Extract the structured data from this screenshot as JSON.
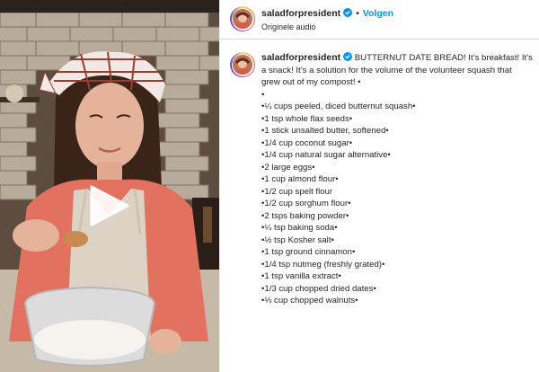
{
  "header": {
    "username": "saladforpresident",
    "verified_icon": "verified-badge-icon",
    "follow_label": "Volgen",
    "audio_label": "Originele audio"
  },
  "caption": {
    "username": "saladforpresident",
    "lead_text": "BUTTERNUT DATE BREAD! It’s breakfast! It’s a snack! It’s a solution for the volume of the volunteer squash that grew out of my compost! •",
    "lines": [
      "•",
      "•¼ cups peeled, diced butternut squash•",
      "•1 tsp whole flax seeds•",
      "•1 stick unsalted butter, softened•",
      "•1/4 cup coconut sugar•",
      "•1/4 cup natural sugar alternative•",
      "•2 large eggs•",
      "•1 cup almond flour•",
      "•1/2 cup spelt flour",
      "•1/2 cup sorghum flour•",
      "•2 tsps baking powder•",
      "•¼ tsp baking soda•",
      "•½ tsp Kosher salt•",
      "•1 tsp ground cinnamon•",
      "•1/4 tsp nutmeg (freshly grated)•",
      "•1 tsp vanilla extract•",
      "•1/3 cup chopped dried dates•",
      "•⅓ cup chopped walnuts•"
    ]
  },
  "video": {
    "play_icon": "play-icon"
  },
  "colors": {
    "follow_blue": "#0095f6",
    "verified_blue": "#0095f6",
    "text": "#262626"
  }
}
